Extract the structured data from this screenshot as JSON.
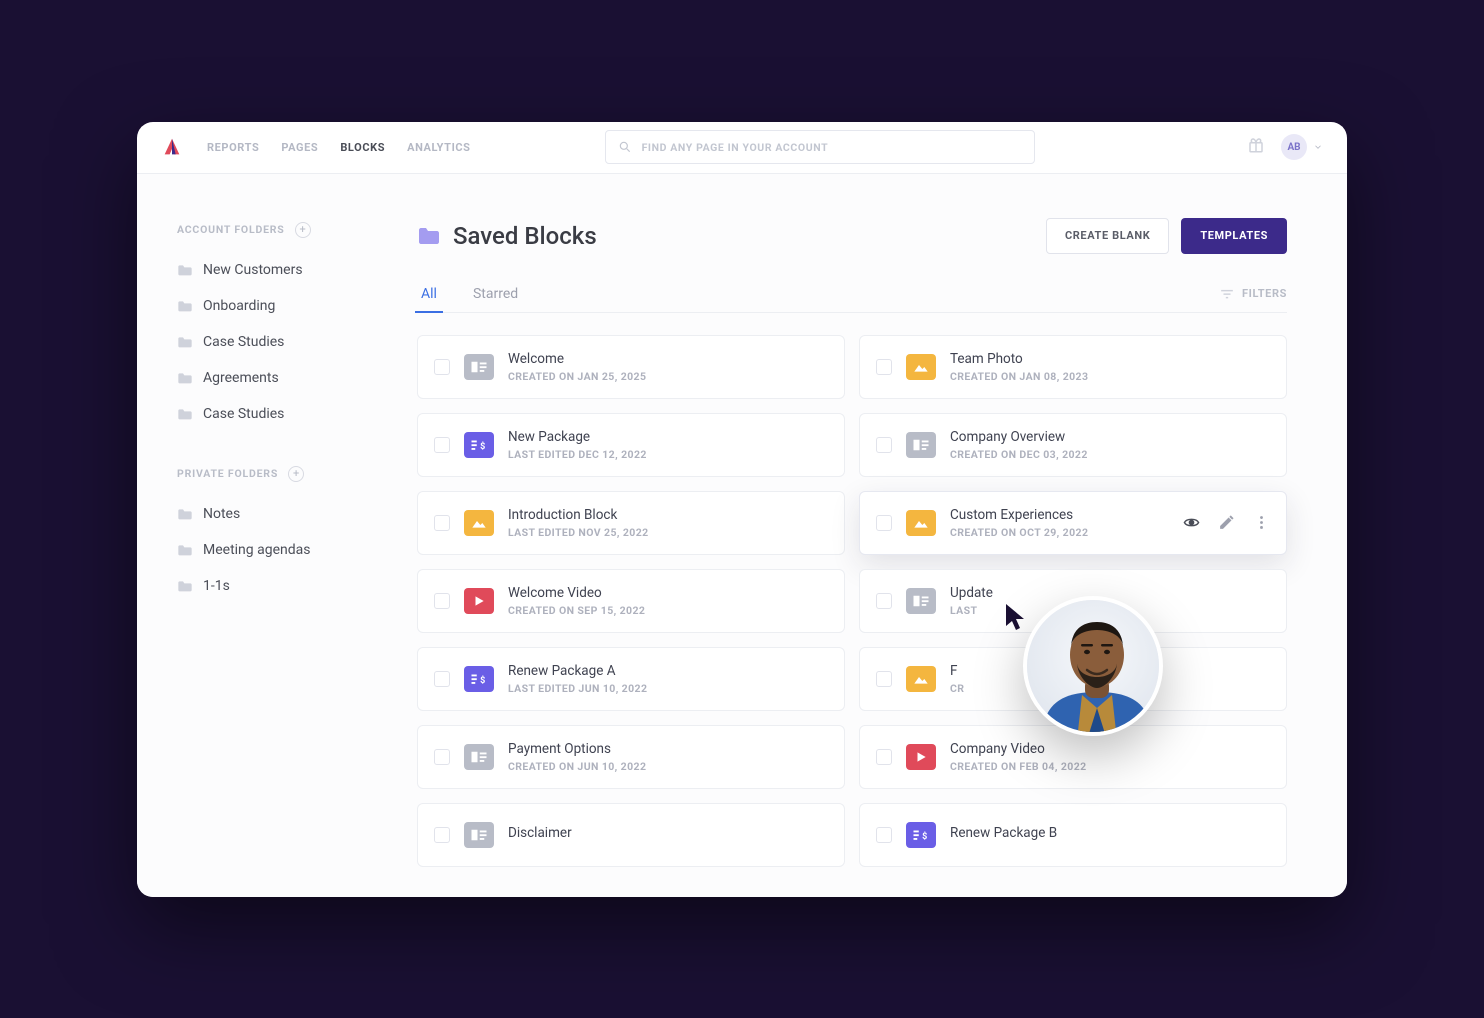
{
  "nav": {
    "items": [
      "REPORTS",
      "PAGES",
      "BLOCKS",
      "ANALYTICS"
    ],
    "active_index": 2
  },
  "search": {
    "placeholder": "FIND ANY PAGE IN YOUR ACCOUNT"
  },
  "user": {
    "initials": "AB"
  },
  "sidebar": {
    "account": {
      "label": "ACCOUNT FOLDERS",
      "items": [
        "New Customers",
        "Onboarding",
        "Case Studies",
        "Agreements",
        "Case Studies"
      ]
    },
    "private": {
      "label": "PRIVATE FOLDERS",
      "items": [
        "Notes",
        "Meeting agendas",
        "1-1s"
      ]
    }
  },
  "page": {
    "title": "Saved Blocks",
    "buttons": {
      "create_blank": "CREATE BLANK",
      "templates": "TEMPLATES"
    },
    "tabs": {
      "items": [
        "All",
        "Starred"
      ],
      "active_index": 0
    },
    "filters_label": "FILTERS"
  },
  "blocks": {
    "left": [
      {
        "type": "text",
        "title": "Welcome",
        "meta": "CREATED ON JAN 25, 2025"
      },
      {
        "type": "price",
        "title": "New Package",
        "meta": "LAST EDITED DEC 12, 2022"
      },
      {
        "type": "image",
        "title": "Introduction Block",
        "meta": "LAST EDITED NOV 25, 2022"
      },
      {
        "type": "video",
        "title": "Welcome Video",
        "meta": "CREATED ON SEP 15, 2022"
      },
      {
        "type": "price",
        "title": "Renew Package A",
        "meta": "LAST EDITED JUN 10, 2022"
      },
      {
        "type": "text",
        "title": "Payment Options",
        "meta": "CREATED ON JUN 10, 2022"
      },
      {
        "type": "text",
        "title": "Disclaimer",
        "meta": ""
      }
    ],
    "right": [
      {
        "type": "image",
        "title": "Team Photo",
        "meta": "CREATED ON JAN 08, 2023"
      },
      {
        "type": "text",
        "title": "Company Overview",
        "meta": "CREATED ON DEC 03, 2022"
      },
      {
        "type": "image",
        "title": "Custom Experiences",
        "meta": "CREATED ON OCT 29, 2022",
        "hover": true
      },
      {
        "type": "text",
        "title": "Update",
        "meta": "LAST"
      },
      {
        "type": "image",
        "title": "F",
        "meta": "CR"
      },
      {
        "type": "video",
        "title": "Company Video",
        "meta": "CREATED ON FEB 04, 2022"
      },
      {
        "type": "price",
        "title": "Renew Package B",
        "meta": ""
      }
    ]
  }
}
